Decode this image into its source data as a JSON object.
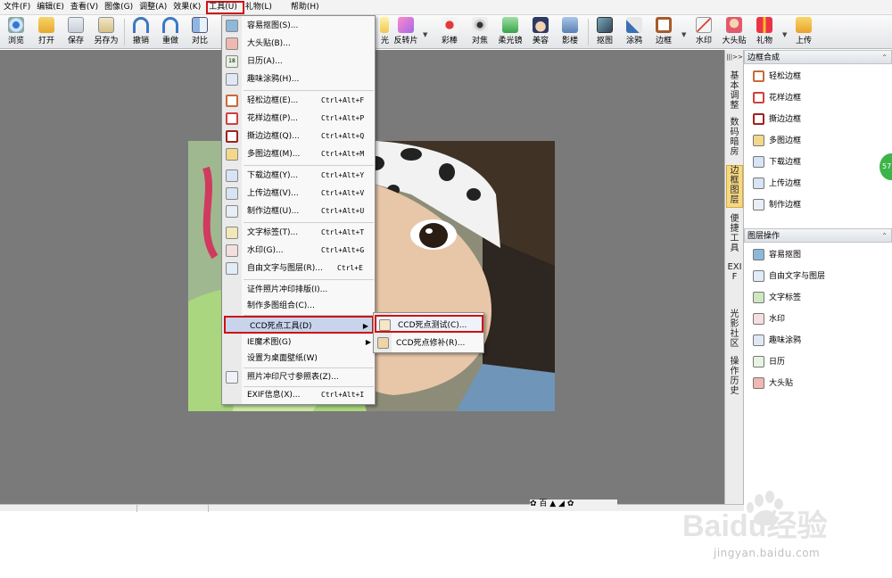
{
  "menubar": [
    {
      "label": "文件(F)"
    },
    {
      "label": "编辑(E)"
    },
    {
      "label": "查看(V)"
    },
    {
      "label": "图像(G)"
    },
    {
      "label": "调整(A)"
    },
    {
      "label": "效果(K)"
    },
    {
      "label": "工具(U)",
      "active": true
    },
    {
      "label": "礼物(L)"
    },
    {
      "label": "帮助(H)"
    }
  ],
  "toolbar": {
    "left": [
      "浏览",
      "打开",
      "保存",
      "另存为",
      "撤销",
      "重做",
      "对比"
    ],
    "right": [
      "光",
      "反转片",
      "彩棒",
      "对焦",
      "柔光镜",
      "美容",
      "影楼",
      "抠图",
      "涂鸦",
      "边框",
      "水印",
      "大头贴",
      "礼物",
      "上传"
    ]
  },
  "tools_menu": {
    "items": [
      {
        "label": "容易抠图(S)...",
        "shortcut": "",
        "icon": "cutout-icon"
      },
      {
        "label": "大头贴(B)...",
        "shortcut": "",
        "icon": "photo-sticker-icon"
      },
      {
        "label": "日历(A)...",
        "shortcut": "",
        "icon": "calendar-icon"
      },
      {
        "label": "趣味涂鸦(H)...",
        "shortcut": "",
        "icon": "doodle-icon"
      },
      {
        "label": "轻松边框(E)...",
        "shortcut": "Ctrl+Alt+F",
        "icon": "frame-icon"
      },
      {
        "label": "花样边框(P)...",
        "shortcut": "Ctrl+Alt+P",
        "icon": "frame-icon"
      },
      {
        "label": "撕边边框(Q)...",
        "shortcut": "Ctrl+Alt+Q",
        "icon": "frame-icon"
      },
      {
        "label": "多图边框(M)...",
        "shortcut": "Ctrl+Alt+M",
        "icon": "multi-frame-icon"
      },
      {
        "label": "下载边框(Y)...",
        "shortcut": "Ctrl+Alt+Y",
        "icon": "download-frame-icon"
      },
      {
        "label": "上传边框(V)...",
        "shortcut": "Ctrl+Alt+V",
        "icon": "upload-frame-icon"
      },
      {
        "label": "制作边框(U)...",
        "shortcut": "Ctrl+Alt+U",
        "icon": "make-frame-icon"
      },
      {
        "label": "文字标签(T)...",
        "shortcut": "Ctrl+Alt+T",
        "icon": "text-label-icon"
      },
      {
        "label": "水印(G)...",
        "shortcut": "Ctrl+Alt+G",
        "icon": "watermark-icon"
      },
      {
        "label": "自由文字与图层(R)...",
        "shortcut": "Ctrl+E",
        "icon": "text-layer-icon"
      },
      {
        "label": "证件照片冲印排版(I)...",
        "shortcut": "",
        "icon": ""
      },
      {
        "label": "制作多图组合(C)...",
        "shortcut": "",
        "icon": ""
      },
      {
        "label": "CCD死点工具(D)",
        "shortcut": "",
        "icon": "",
        "submenu": true,
        "highlighted": true
      },
      {
        "label": "IE魔术图(G)",
        "shortcut": "",
        "icon": "",
        "submenu": true
      },
      {
        "label": "设置为桌面壁纸(W)",
        "shortcut": "",
        "icon": ""
      },
      {
        "label": "照片冲印尺寸参照表(Z)...",
        "shortcut": "",
        "icon": "print-size-icon"
      },
      {
        "label": "EXIF信息(X)...",
        "shortcut": "Ctrl+Alt+I",
        "icon": ""
      }
    ]
  },
  "ccd_submenu": {
    "items": [
      {
        "label": "CCD死点测试(C)...",
        "icon": "ccd-test-icon",
        "highlighted": true
      },
      {
        "label": "CCD死点修补(R)...",
        "icon": "ccd-repair-icon"
      }
    ]
  },
  "vtabs": [
    {
      "label": "基本调整"
    },
    {
      "label": "数码暗房"
    },
    {
      "label": "边框图层",
      "active": true
    },
    {
      "label": "便捷工具"
    },
    {
      "label": "EXIF"
    },
    {
      "label": "光影社区"
    },
    {
      "label": "操作历史"
    }
  ],
  "panel": {
    "frames_title": "边框合成",
    "frames": [
      "轻松边框",
      "花样边框",
      "撕边边框",
      "多图边框",
      "下载边框",
      "上传边框",
      "制作边框"
    ],
    "layers_title": "图层操作",
    "layers": [
      "容易抠图",
      "自由文字与图层",
      "文字标签",
      "水印",
      "趣味涂鸦",
      "日历",
      "大头贴"
    ]
  },
  "panel_strip": {
    "label": "|||>>"
  },
  "edge_badge": "57",
  "zoom_ctrl": {
    "label": "✿ 百 ▲ ◢ ✿"
  },
  "watermark": {
    "logo": "Baidu经验",
    "url": "jingyan.baidu.com"
  },
  "colors": {
    "highlight_border": "#d01010",
    "menu_highlight": "#c7d4ec",
    "canvas_bg": "#7a7a7a",
    "active_tab": "#f5d884"
  }
}
